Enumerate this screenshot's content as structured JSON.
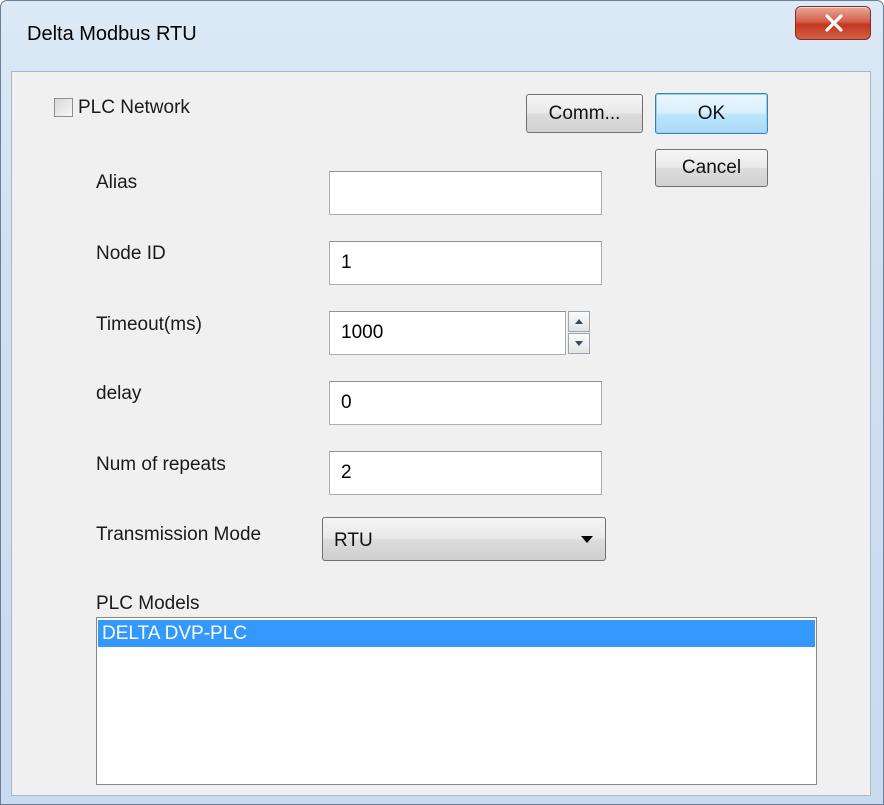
{
  "window": {
    "title": "Delta Modbus RTU"
  },
  "checkbox": {
    "label": "PLC Network",
    "checked": false
  },
  "buttons": {
    "comm": "Comm...",
    "ok": "OK",
    "cancel": "Cancel"
  },
  "fields": {
    "alias": {
      "label": "Alias",
      "value": ""
    },
    "node_id": {
      "label": "Node ID",
      "value": "1"
    },
    "timeout": {
      "label": "Timeout(ms)",
      "value": "1000"
    },
    "delay": {
      "label": "delay",
      "value": "0"
    },
    "repeats": {
      "label": "Num of repeats",
      "value": "2"
    }
  },
  "transmission": {
    "label": "Transmission Mode",
    "selected": "RTU"
  },
  "plc_models": {
    "label": "PLC Models",
    "items": [
      "DELTA DVP-PLC"
    ],
    "selected_index": 0
  },
  "icons": {
    "close": "close-icon",
    "spin_up": "spin-up-icon",
    "spin_down": "spin-down-icon",
    "dropdown": "chevron-down-icon"
  },
  "colors": {
    "selection": "#3399ff",
    "close_button": "#c2381f",
    "title_bar": "#cfe0f1"
  }
}
